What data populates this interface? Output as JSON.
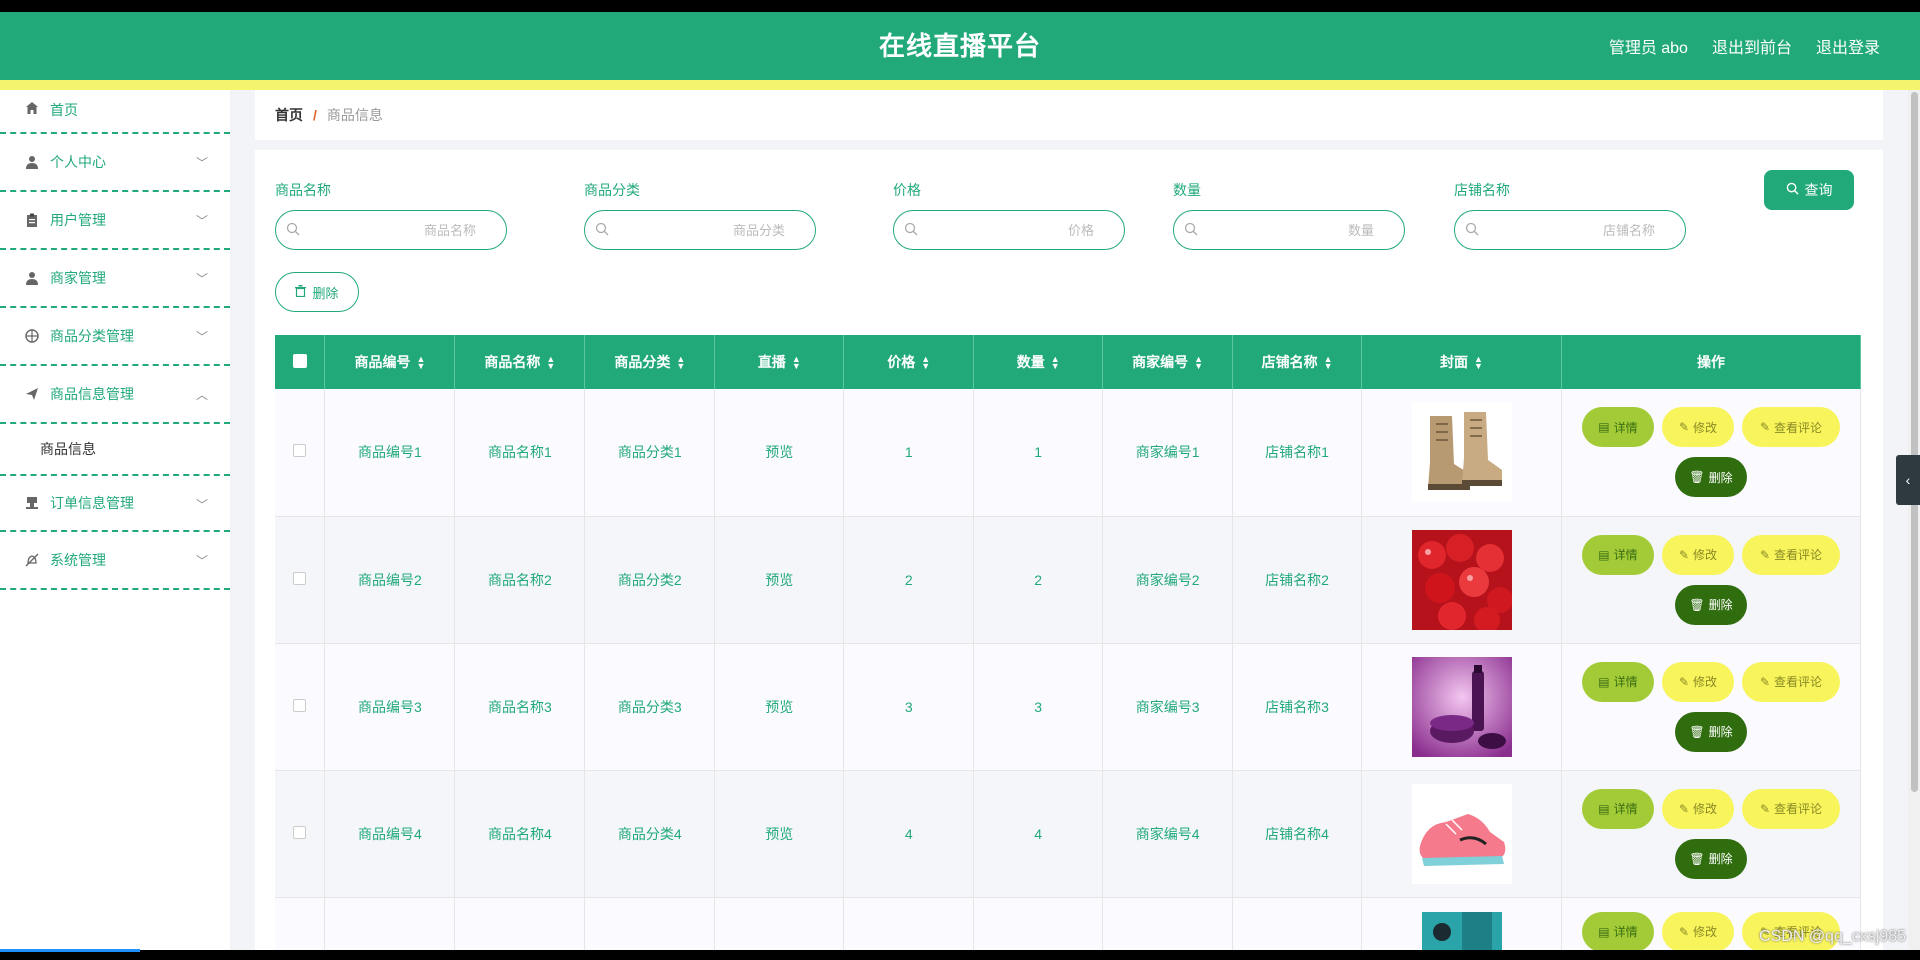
{
  "header": {
    "title": "在线直播平台",
    "admin": "管理员 abo",
    "to_front": "退出到前台",
    "logout": "退出登录"
  },
  "sidebar": {
    "items": [
      {
        "label": "首页",
        "icon": "home-icon"
      },
      {
        "label": "个人中心",
        "icon": "user-icon"
      },
      {
        "label": "用户管理",
        "icon": "clipboard-icon"
      },
      {
        "label": "商家管理",
        "icon": "user-icon"
      },
      {
        "label": "商品分类管理",
        "icon": "globe-icon"
      },
      {
        "label": "商品信息管理",
        "icon": "send-icon"
      },
      {
        "label": "订单信息管理",
        "icon": "stamp-icon"
      },
      {
        "label": "系统管理",
        "icon": "bell-off-icon"
      }
    ],
    "sub_item": "商品信息"
  },
  "breadcrumb": {
    "home": "首页",
    "sep": "/",
    "current": "商品信息"
  },
  "search": {
    "fields": [
      {
        "label": "商品名称",
        "placeholder": "商品名称"
      },
      {
        "label": "商品分类",
        "placeholder": "商品分类"
      },
      {
        "label": "价格",
        "placeholder": "价格"
      },
      {
        "label": "数量",
        "placeholder": "数量"
      },
      {
        "label": "店铺名称",
        "placeholder": "店铺名称"
      }
    ],
    "query_label": "查询",
    "delete_label": "删除"
  },
  "table": {
    "headers": [
      "商品编号",
      "商品名称",
      "商品分类",
      "直播",
      "价格",
      "数量",
      "商家编号",
      "店铺名称",
      "封面",
      "操作"
    ],
    "rows": [
      {
        "id": "商品编号1",
        "name": "商品名称1",
        "category": "商品分类1",
        "live": "预览",
        "price": "1",
        "qty": "1",
        "merchant": "商家编号1",
        "shop": "店铺名称1",
        "cover": "boots-image"
      },
      {
        "id": "商品编号2",
        "name": "商品名称2",
        "category": "商品分类2",
        "live": "预览",
        "price": "2",
        "qty": "2",
        "merchant": "商家编号2",
        "shop": "店铺名称2",
        "cover": "cherries-image"
      },
      {
        "id": "商品编号3",
        "name": "商品名称3",
        "category": "商品分类3",
        "live": "预览",
        "price": "3",
        "qty": "3",
        "merchant": "商家编号3",
        "shop": "店铺名称3",
        "cover": "cosmetics-image"
      },
      {
        "id": "商品编号4",
        "name": "商品名称4",
        "category": "商品分类4",
        "live": "预览",
        "price": "4",
        "qty": "4",
        "merchant": "商家编号4",
        "shop": "店铺名称4",
        "cover": "sneaker-image"
      }
    ],
    "actions": {
      "detail": "详情",
      "edit": "修改",
      "review": "查看评论",
      "delete": "删除"
    }
  },
  "watermark": "CSDN @qq_cxsj985",
  "colors": {
    "primary": "#22a97a",
    "accent_yellow": "#f8f45c",
    "detail_green": "#a3cb38",
    "delete_dark": "#2f6d0f"
  }
}
